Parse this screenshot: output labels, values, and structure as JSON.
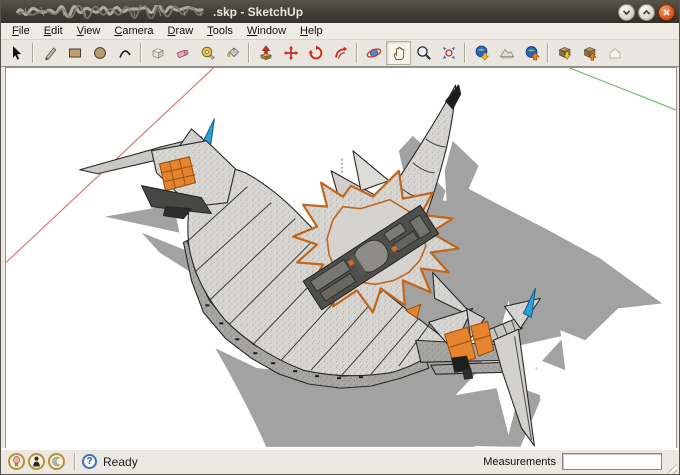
{
  "window": {
    "title_suffix": ".skp - SketchUp",
    "controls": {
      "minimize": "minimize",
      "maximize": "maximize",
      "close": "close"
    }
  },
  "menubar": {
    "items": [
      {
        "label": "File"
      },
      {
        "label": "Edit"
      },
      {
        "label": "View"
      },
      {
        "label": "Camera"
      },
      {
        "label": "Draw"
      },
      {
        "label": "Tools"
      },
      {
        "label": "Window"
      },
      {
        "label": "Help"
      }
    ]
  },
  "toolbar": {
    "active_tool": "Pan",
    "tools": [
      {
        "name": "Select"
      },
      {
        "name": "Line"
      },
      {
        "name": "Rectangle"
      },
      {
        "name": "Circle"
      },
      {
        "name": "Arc"
      },
      {
        "name": "Make Component"
      },
      {
        "name": "Eraser"
      },
      {
        "name": "Tape Measure"
      },
      {
        "name": "Paint Bucket"
      },
      {
        "name": "Push/Pull"
      },
      {
        "name": "Move"
      },
      {
        "name": "Rotate"
      },
      {
        "name": "Offset"
      },
      {
        "name": "Orbit"
      },
      {
        "name": "Pan"
      },
      {
        "name": "Zoom"
      },
      {
        "name": "Zoom Extents"
      },
      {
        "name": "Get Current View"
      },
      {
        "name": "Toggle Terrain"
      },
      {
        "name": "Place Model"
      },
      {
        "name": "Get Models"
      },
      {
        "name": "Share Models"
      },
      {
        "name": "Share Component"
      }
    ]
  },
  "canvas": {
    "content_description": "Crescent-shaped fantasy airship 3D model with orange panel accents, blue fin spikes and gray drop shadow",
    "axis_colors": {
      "red": "#d96b6b",
      "green": "#69b963",
      "blue": "#3a5fc8"
    }
  },
  "statusbar": {
    "help_glyph": "?",
    "status_text": "Ready",
    "measurements_label": "Measurements",
    "measurements_value": ""
  }
}
